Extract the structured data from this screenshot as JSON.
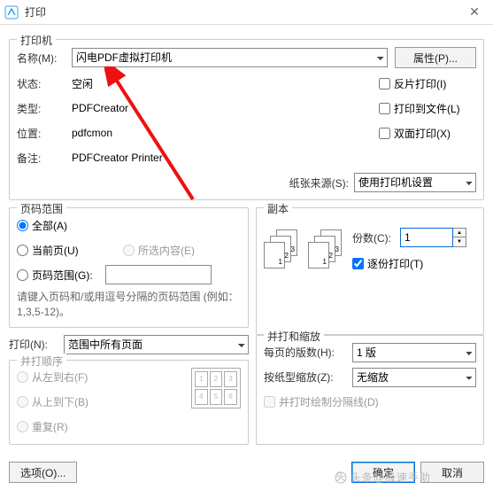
{
  "window": {
    "title": "打印"
  },
  "printer": {
    "legend": "打印机",
    "name_label": "名称(M):",
    "name_value": "闪电PDF虚拟打印机",
    "properties_btn": "属性(P)...",
    "status_label": "状态:",
    "status_value": "空闲",
    "type_label": "类型:",
    "type_value": "PDFCreator",
    "where_label": "位置:",
    "where_value": "pdfcmon",
    "comment_label": "备注:",
    "comment_value": "PDFCreator Printer",
    "mirror_cb": "反片打印(I)",
    "tofile_cb": "打印到文件(L)",
    "duplex_cb": "双面打印(X)",
    "paper_label": "纸张来源(S):",
    "paper_value": "使用打印机设置"
  },
  "range": {
    "legend": "页码范围",
    "all": "全部(A)",
    "current": "当前页(U)",
    "selection": "所选内容(E)",
    "pages": "页码范围(G):",
    "hint": "请键入页码和/或用逗号分隔的页码范围 (例如：1,3,5-12)。"
  },
  "copies": {
    "legend": "副本",
    "count_label": "份数(C):",
    "count_value": "1",
    "collate_cb": "逐份打印(T)"
  },
  "prn": {
    "label": "打印(N):",
    "value": "范围中所有页面"
  },
  "merge": {
    "legend": "并打和缩放",
    "pages_per_label": "每页的版数(H):",
    "pages_per_value": "1 版",
    "scale_label": "按纸型缩放(Z):",
    "scale_value": "无缩放",
    "divider_cb": "并打时绘制分隔线(D)"
  },
  "order": {
    "legend": "并打顺序",
    "lr": "从左到右(F)",
    "tb": "从上到下(B)",
    "rep": "重复(R)"
  },
  "buttons": {
    "options": "选项(O)...",
    "ok": "确定",
    "cancel": "取消"
  },
  "watermark": "头条@极速手助"
}
